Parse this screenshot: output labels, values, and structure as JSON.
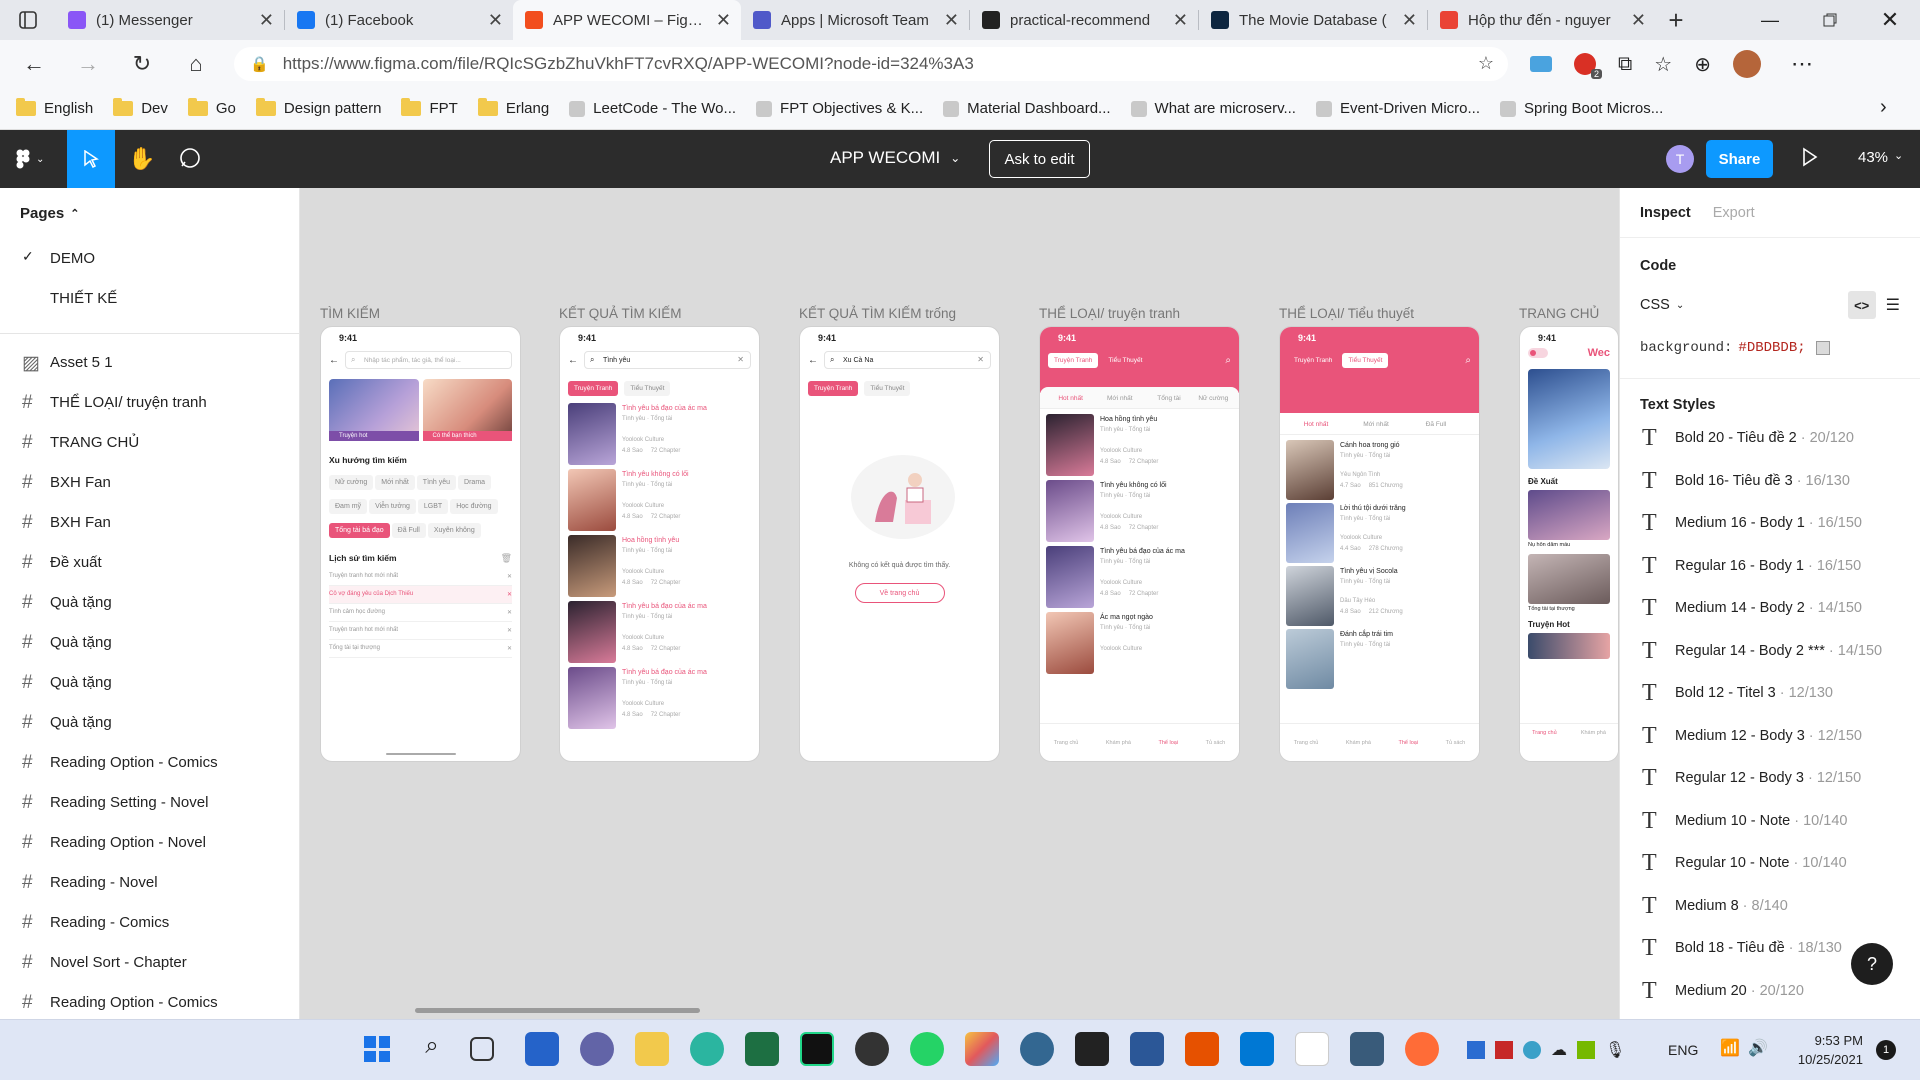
{
  "browser": {
    "tabs": [
      {
        "title": "(1) Messenger",
        "color": "#8a56f6"
      },
      {
        "title": "(1) Facebook",
        "color": "#1877f2"
      },
      {
        "title": "APP WECOMI – Figma",
        "color": "#f24e1e",
        "active": true
      },
      {
        "title": "Apps | Microsoft Team",
        "color": "#5059c9"
      },
      {
        "title": "practical-recommend",
        "color": "#222222"
      },
      {
        "title": "The Movie Database (",
        "color": "#0d253f"
      },
      {
        "title": "Hộp thư đến - nguyer",
        "color": "#ea4335"
      }
    ],
    "url": "https://www.figma.com/file/RQIcSGzbZhuVkhFT7cvRXQ/APP-WECOMI?node-id=324%3A3",
    "bookmarks": [
      "English",
      "Dev",
      "Go",
      "Design pattern",
      "FPT",
      "Erlang",
      "LeetCode - The Wo...",
      "FPT Objectives & K...",
      "Material Dashboard...",
      "What are microserv...",
      "Event-Driven Micro...",
      "Spring Boot Micros..."
    ]
  },
  "figma": {
    "file_title": "APP WECOMI",
    "ask_to_edit": "Ask to edit",
    "avatar_letter": "T",
    "share": "Share",
    "zoom": "43%",
    "pages_heading": "Pages",
    "pages": [
      "DEMO",
      "THIẾT KẾ"
    ],
    "layers": [
      "Asset 5 1",
      "THỂ LOẠI/ truyện tranh",
      "TRANG CHỦ",
      "BXH Fan",
      "BXH Fan",
      "Đề xuất",
      "Quà tặng",
      "Quà tặng",
      "Quà tặng",
      "Quà tặng",
      "Reading Option - Comics",
      "Reading Setting - Novel",
      "Reading Option - Novel",
      "Reading - Novel",
      "Reading - Comics",
      "Novel Sort - Chapter",
      "Reading Option - Comics"
    ],
    "frames": [
      {
        "label": "TÌM KIẾM"
      },
      {
        "label": "KẾT QUẢ TÌM KIẾM"
      },
      {
        "label": "KẾT QUẢ TÌM KIẾM trống"
      },
      {
        "label": "THỂ LOẠI/ truyện tranh"
      },
      {
        "label": "THỂ LOẠI/ Tiểu thuyết"
      },
      {
        "label": "TRANG CHỦ"
      }
    ],
    "inspect": {
      "tab_inspect": "Inspect",
      "tab_export": "Export",
      "code_heading": "Code",
      "code_lang": "CSS",
      "css_prop": "background:",
      "css_value": "#DBDBDB;",
      "text_styles_heading": "Text Styles",
      "text_styles": [
        {
          "name": "Bold 20 - Tiêu đề 2",
          "meta": "20/120"
        },
        {
          "name": "Bold 16- Tiêu đề 3",
          "meta": "16/130"
        },
        {
          "name": "Medium 16 - Body 1",
          "meta": "16/150"
        },
        {
          "name": "Regular 16 - Body 1",
          "meta": "16/150"
        },
        {
          "name": "Medium 14 - Body 2",
          "meta": "14/150"
        },
        {
          "name": "Regular 14 - Body 2 ***",
          "meta": "14/150"
        },
        {
          "name": "Bold 12 - Titel 3",
          "meta": "12/130"
        },
        {
          "name": "Medium 12 - Body 3",
          "meta": "12/150"
        },
        {
          "name": "Regular 12 - Body 3",
          "meta": "12/150"
        },
        {
          "name": "Medium 10 - Note",
          "meta": "10/140"
        },
        {
          "name": "Regular 10 - Note",
          "meta": "10/140"
        },
        {
          "name": "Medium 8",
          "meta": "8/140"
        },
        {
          "name": "Bold 18 - Tiêu đề",
          "meta": "18/130"
        },
        {
          "name": "Medium 20",
          "meta": "20/120"
        }
      ],
      "help": "?"
    }
  },
  "mock": {
    "time": "9:41",
    "search_placeholder": "Nhập tác phẩm, tác giả, thể loại...",
    "trending": "Xu hướng tìm kiếm",
    "tags": [
      "Nữ cường",
      "Mới nhất",
      "Tình yêu",
      "Drama",
      "Đam mỹ",
      "Viễn tưởng",
      "LGBT",
      "Học đường",
      "Tổng tài bá đạo",
      "Đã Full",
      "Xuyên không"
    ],
    "history_heading": "Lịch sử tìm kiếm",
    "history": [
      "Truyện tranh hot mới nhất",
      "Cô vợ đáng yêu của Dịch Thiếu",
      "Tình cảm học đường",
      "Truyện tranh hot mới nhất",
      "Tổng tài tại thượng"
    ],
    "banner1": "Truyện hot",
    "banner2": "Có thể bạn thích",
    "q1": "Tình yêu",
    "q2": "Xu Cà Na",
    "tab_comic": "Truyện Tranh",
    "tab_novel": "Tiểu Thuyết",
    "results": [
      "Tình yêu bá đạo của ác ma",
      "Tình yêu không có lối",
      "Hoa hồng tình yêu",
      "Tình yêu bá đạo của ác ma",
      "Tình yêu bá đạo của ác ma"
    ],
    "meta": "Tình yêu · Tổng tài",
    "author": "Yoolook Culture",
    "rating": "4.8 Sao",
    "chapters": "72 Chapter",
    "empty_text": "Không có kết quả được tìm thấy.",
    "back_home": "Về trang chủ",
    "sub_tabs": [
      "Hot nhất",
      "Mới nhất",
      "Tổng tài",
      "Nữ cường"
    ],
    "sub_tabs2": [
      "Hot nhất",
      "Mới nhất",
      "Đã Full"
    ],
    "comics": [
      "Hoa hồng tình yêu",
      "Tình yêu không có lối",
      "Tình yêu bá đạo của ác ma",
      "Ác ma ngọt ngào"
    ],
    "novels": [
      "Cánh hoa trong gió",
      "Lời thú tội dưới trăng",
      "Tình yêu vị Socola",
      "Đánh cắp trái tim"
    ],
    "novel_authors": [
      "Yêu Ngôn Tình",
      "Yoolook Culture",
      "Dâu Tây Héo",
      ""
    ],
    "novel_ratings": [
      "4.7 Sao",
      "4.4 Sao",
      "4.8 Sao"
    ],
    "novel_chapters": [
      "851 Chương",
      "278 Chương",
      "212 Chương"
    ],
    "nav": [
      "Trang chủ",
      "Khám phá",
      "Thể loại",
      "Tủ sách"
    ],
    "home_sections": [
      "Đề Xuất",
      "Truyện Hot"
    ],
    "home_items": [
      "Nụ hôn dâm máu",
      "Tổng tài tại thượng"
    ],
    "brand": "Wec"
  },
  "taskbar": {
    "time": "9:53 PM",
    "date": "10/25/2021",
    "lang": "ENG",
    "notif": "1"
  }
}
